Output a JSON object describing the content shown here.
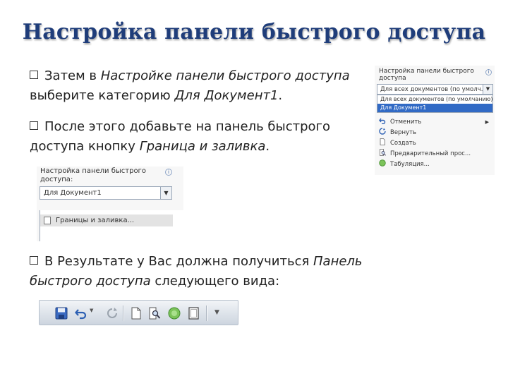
{
  "title": "Настройка панели быстрого доступа",
  "paragraph1": {
    "t1": "Затем в ",
    "t2": "Настройке панели быстрого доступа",
    "t3": " выберите категорию ",
    "t4": "Для Документ1",
    "t5": "."
  },
  "paragraph2": {
    "t1": "После этого добавьте на панель быстрого доступа кнопку ",
    "t2": "Граница и заливка",
    "t3": "."
  },
  "paragraph3": {
    "t1": "В Результате у Вас должна получиться ",
    "t2": "Панель быстрого доступа",
    "t3": " следующего вида:"
  },
  "dialog_right": {
    "header": "Настройка панели быстрого доступа",
    "info": "i",
    "combo_value": "Для всех документов (по умолч...",
    "options": [
      "Для всех документов (по умолчанию)",
      "Для Документ1"
    ],
    "commands": [
      "Отменить",
      "Вернуть",
      "Создать",
      "Предварительный прос...",
      "Табуляция..."
    ]
  },
  "dialog_left": {
    "header": "Настройка панели быстрого доступа:",
    "info": "i",
    "combo_value": "Для Документ1",
    "list_item": "Границы и заливка..."
  },
  "colors": {
    "title": "#1f3d7a",
    "selection": "#316ac5",
    "toolbar": "#dde3ea"
  }
}
